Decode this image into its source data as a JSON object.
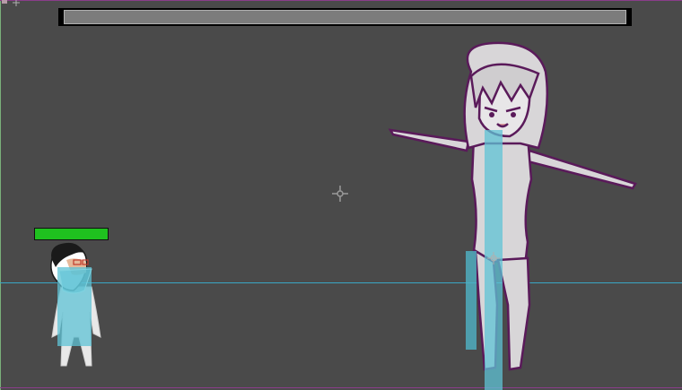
{
  "game": {
    "colors": {
      "background": "#4a4a4a",
      "health": "#1fc11f",
      "hitbox": "#5fc3d6",
      "ground_line": "#3aa6c4",
      "enemy_outline": "#5a1a5a"
    },
    "boss_bar": {
      "fill_fraction": 1.0,
      "color": "#7c7c7c"
    },
    "player": {
      "health_fraction": 1.0,
      "sprite": "chibi-boy-with-glasses"
    },
    "enemy": {
      "sprite": "anime-girl-t-pose-sketch"
    },
    "icons": [
      "crosshair-icon",
      "pivot-marker-icon"
    ]
  }
}
